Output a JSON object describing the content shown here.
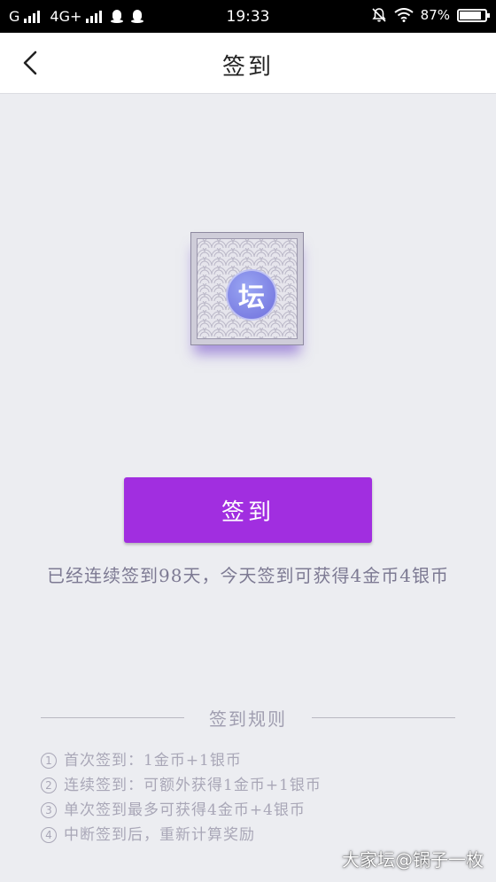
{
  "status_bar": {
    "carrier": "G",
    "network": "4G+",
    "time": "19:33",
    "battery": "87%",
    "battery_level": 0.87
  },
  "nav": {
    "title": "签到"
  },
  "logo": {
    "glyph": "坛"
  },
  "checkin": {
    "button_label": "签到",
    "streak_message": "已经连续签到98天，今天签到可获得4金币4银币"
  },
  "rules": {
    "title": "签到规则",
    "items": [
      {
        "num": "1",
        "text": "首次签到：1金币+1银币"
      },
      {
        "num": "2",
        "text": "连续签到：可额外获得1金币+1银币"
      },
      {
        "num": "3",
        "text": "单次签到最多可获得4金币+4银币"
      },
      {
        "num": "4",
        "text": "中断签到后，重新计算奖励"
      }
    ]
  },
  "watermark": "大家坛@锅子一枚",
  "colors": {
    "accent": "#a12ee0",
    "background": "#ecedf1",
    "text_muted": "#a9a7b7"
  }
}
